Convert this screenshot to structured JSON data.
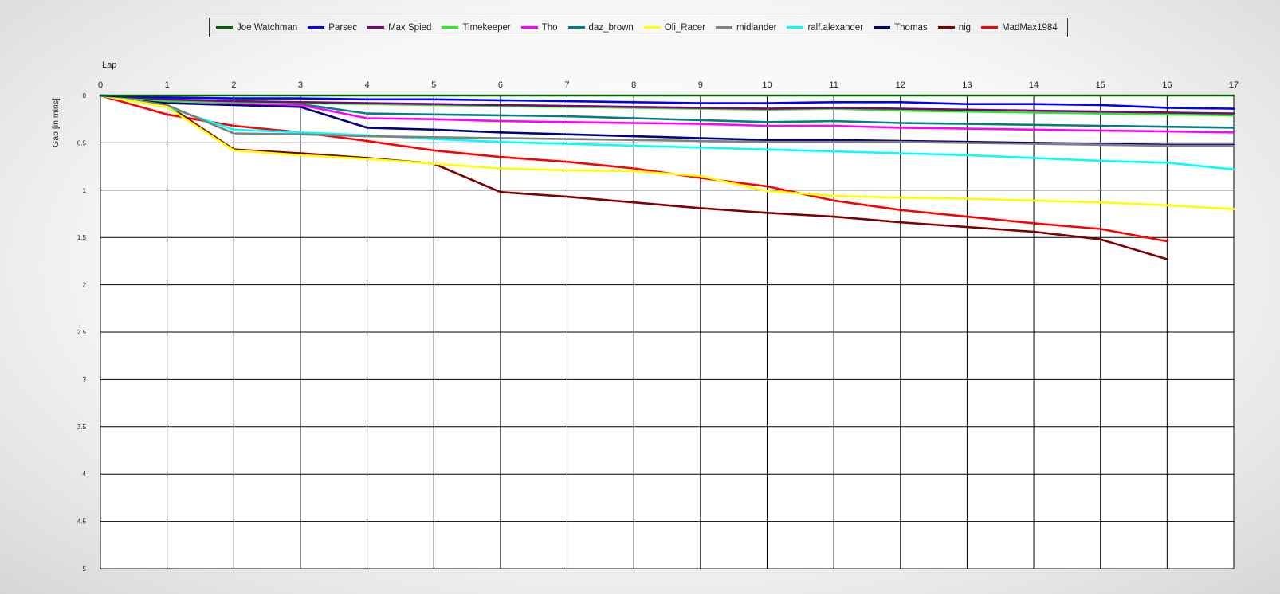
{
  "chart_data": {
    "type": "line",
    "title": "",
    "xlabel": "Lap",
    "ylabel": "Gap [in mins]",
    "xlim": [
      0,
      17
    ],
    "ylim": [
      0,
      5
    ],
    "y_inverted": true,
    "x_ticks": [
      "0",
      "1",
      "2",
      "3",
      "4",
      "5",
      "6",
      "7",
      "8",
      "9",
      "10",
      "11",
      "12",
      "13",
      "14",
      "15",
      "16",
      "17"
    ],
    "y_ticks": [
      "0",
      "0.5",
      "1",
      "1.5",
      "2",
      "2.5",
      "3",
      "3.5",
      "4",
      "4.5",
      "5"
    ],
    "grid": true,
    "legend_position": "top",
    "x": [
      0,
      1,
      2,
      3,
      4,
      5,
      6,
      7,
      8,
      9,
      10,
      11,
      12,
      13,
      14,
      15,
      16,
      17
    ],
    "series": [
      {
        "name": "Joe Watchman",
        "color": "#006400",
        "values": [
          0,
          0,
          0,
          0,
          0,
          0,
          0,
          0,
          0,
          0,
          0,
          0,
          0,
          0,
          0,
          0,
          0,
          0
        ]
      },
      {
        "name": "Parsec",
        "color": "#0000ff",
        "values": [
          0,
          0.02,
          0.03,
          0.03,
          0.04,
          0.04,
          0.05,
          0.06,
          0.07,
          0.08,
          0.08,
          0.07,
          0.07,
          0.09,
          0.09,
          0.1,
          0.13,
          0.14
        ]
      },
      {
        "name": "Max Spied",
        "color": "#800080",
        "values": [
          0,
          0.04,
          0.06,
          0.07,
          0.08,
          0.09,
          0.1,
          0.11,
          0.12,
          0.13,
          0.14,
          0.13,
          0.14,
          0.15,
          0.16,
          0.17,
          0.18,
          0.19
        ]
      },
      {
        "name": "Timekeeper",
        "color": "#22ee22",
        "values": [
          0,
          0.06,
          0.07,
          0.08,
          0.09,
          0.1,
          0.11,
          0.12,
          0.13,
          0.14,
          0.15,
          0.14,
          0.16,
          0.17,
          0.18,
          0.19,
          0.2,
          0.21
        ]
      },
      {
        "name": "Tho",
        "color": "#ff00ff",
        "values": [
          0,
          0.05,
          0.08,
          0.1,
          0.24,
          0.25,
          0.27,
          0.28,
          0.29,
          0.3,
          0.32,
          0.32,
          0.34,
          0.35,
          0.36,
          0.37,
          0.38,
          0.39
        ]
      },
      {
        "name": "daz_brown",
        "color": "#008080",
        "values": [
          0,
          0.04,
          0.08,
          0.09,
          0.19,
          0.2,
          0.21,
          0.22,
          0.24,
          0.26,
          0.28,
          0.27,
          0.29,
          0.3,
          0.31,
          0.32,
          0.33,
          0.34
        ]
      },
      {
        "name": "Oli_Racer",
        "color": "#ffff00",
        "values": [
          0,
          0.12,
          0.58,
          0.63,
          0.67,
          0.72,
          0.77,
          0.79,
          0.8,
          0.85,
          1.01,
          1.06,
          1.08,
          1.09,
          1.11,
          1.13,
          1.16,
          1.2
        ]
      },
      {
        "name": "midlander",
        "color": "#808080",
        "values": [
          0,
          0.1,
          0.4,
          0.41,
          0.43,
          0.44,
          0.45,
          0.46,
          0.47,
          0.48,
          0.49,
          0.49,
          0.49,
          0.5,
          0.51,
          0.52,
          0.53,
          0.53
        ]
      },
      {
        "name": "ralf.alexander",
        "color": "#00ffff",
        "values": [
          0,
          0.12,
          0.36,
          0.39,
          0.42,
          0.46,
          0.49,
          0.51,
          0.53,
          0.55,
          0.57,
          0.59,
          0.61,
          0.63,
          0.66,
          0.69,
          0.71,
          0.78
        ]
      },
      {
        "name": "Thomas",
        "color": "#000080",
        "values": [
          0,
          0.08,
          0.1,
          0.12,
          0.34,
          0.36,
          0.39,
          0.41,
          0.43,
          0.45,
          0.47,
          0.47,
          0.48,
          0.49,
          0.5,
          0.51,
          0.52,
          0.52
        ]
      },
      {
        "name": "nig",
        "color": "#800000",
        "values": [
          0,
          0.1,
          0.57,
          0.61,
          0.66,
          0.72,
          1.02,
          1.07,
          1.13,
          1.19,
          1.24,
          1.28,
          1.34,
          1.39,
          1.44,
          1.52,
          1.73,
          null
        ]
      },
      {
        "name": "MadMax1984",
        "color": "#ff0000",
        "values": [
          0,
          0.2,
          0.32,
          0.39,
          0.48,
          0.58,
          0.65,
          0.7,
          0.77,
          0.87,
          0.96,
          1.11,
          1.21,
          1.28,
          1.35,
          1.41,
          1.54,
          null
        ]
      }
    ]
  }
}
